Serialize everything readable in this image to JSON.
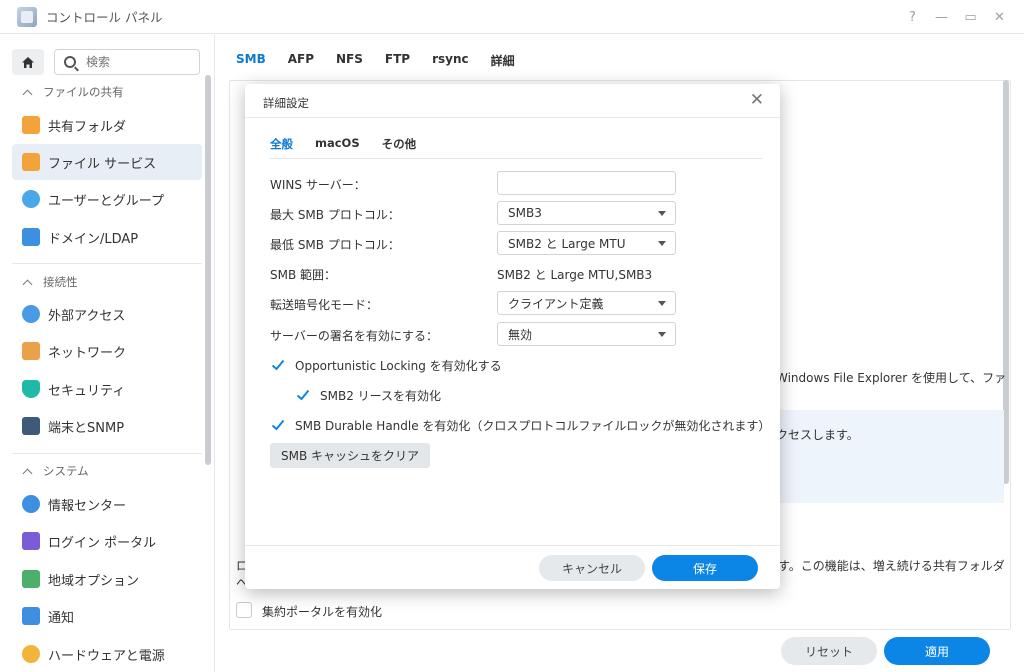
{
  "window": {
    "title": "コントロール パネル",
    "controls": {
      "help": "?",
      "minimize": "—",
      "maximize": "▭",
      "close": "✕"
    }
  },
  "sidebar": {
    "search_placeholder": "検索",
    "sections": [
      {
        "title": "ファイルの共有",
        "items": [
          "共有フォルダ",
          "ファイル サービス",
          "ユーザーとグループ",
          "ドメイン/LDAP"
        ]
      },
      {
        "title": "接続性",
        "items": [
          "外部アクセス",
          "ネットワーク",
          "セキュリティ",
          "端末とSNMP"
        ]
      },
      {
        "title": "システム",
        "items": [
          "情報センター",
          "ログイン ポータル",
          "地域オプション",
          "通知",
          "ハードウェアと電源"
        ]
      }
    ],
    "active_item": "ファイル サービス"
  },
  "main": {
    "tabs": [
      "SMB",
      "AFP",
      "NFS",
      "FTP",
      "rsync",
      "詳細"
    ],
    "active_tab": "SMB",
    "bg_text_1": "Windows File Explorer を使用して、ファ",
    "bg_text_2": "クセスします。",
    "bg_text_3": "ロ",
    "bg_text_4": "へ",
    "bg_text_5": "す。この機能は、増え続ける共有フォルダ",
    "bg_checkbox_label": "集約ポータルを有効化",
    "reset_label": "リセット",
    "apply_label": "適用"
  },
  "modal": {
    "title": "詳細設定",
    "close": "✕",
    "tabs": [
      "全般",
      "macOS",
      "その他"
    ],
    "active_tab": "全般",
    "fields": {
      "wins_label": "WINS サーバー：",
      "wins_value": "",
      "max_smb_label": "最大 SMB プロトコル：",
      "max_smb_value": "SMB3",
      "min_smb_label": "最低 SMB プロトコル：",
      "min_smb_value": "SMB2 と Large MTU",
      "range_label": "SMB 範囲：",
      "range_value": "SMB2 と Large MTU,SMB3",
      "encrypt_label": "転送暗号化モード：",
      "encrypt_value": "クライアント定義",
      "sign_label": "サーバーの署名を有効にする：",
      "sign_value": "無効"
    },
    "checkboxes": {
      "oplock": "Opportunistic Locking を有効化する",
      "lease": "SMB2 リースを有効化",
      "durable": "SMB Durable Handle を有効化（クロスプロトコルファイルロックが無効化されます）"
    },
    "clear_cache_label": "SMB キャッシュをクリア",
    "cancel_label": "キャンセル",
    "save_label": "保存"
  },
  "colors": {
    "accent": "#0b86e6",
    "active_tab": "#0b7ad1"
  }
}
